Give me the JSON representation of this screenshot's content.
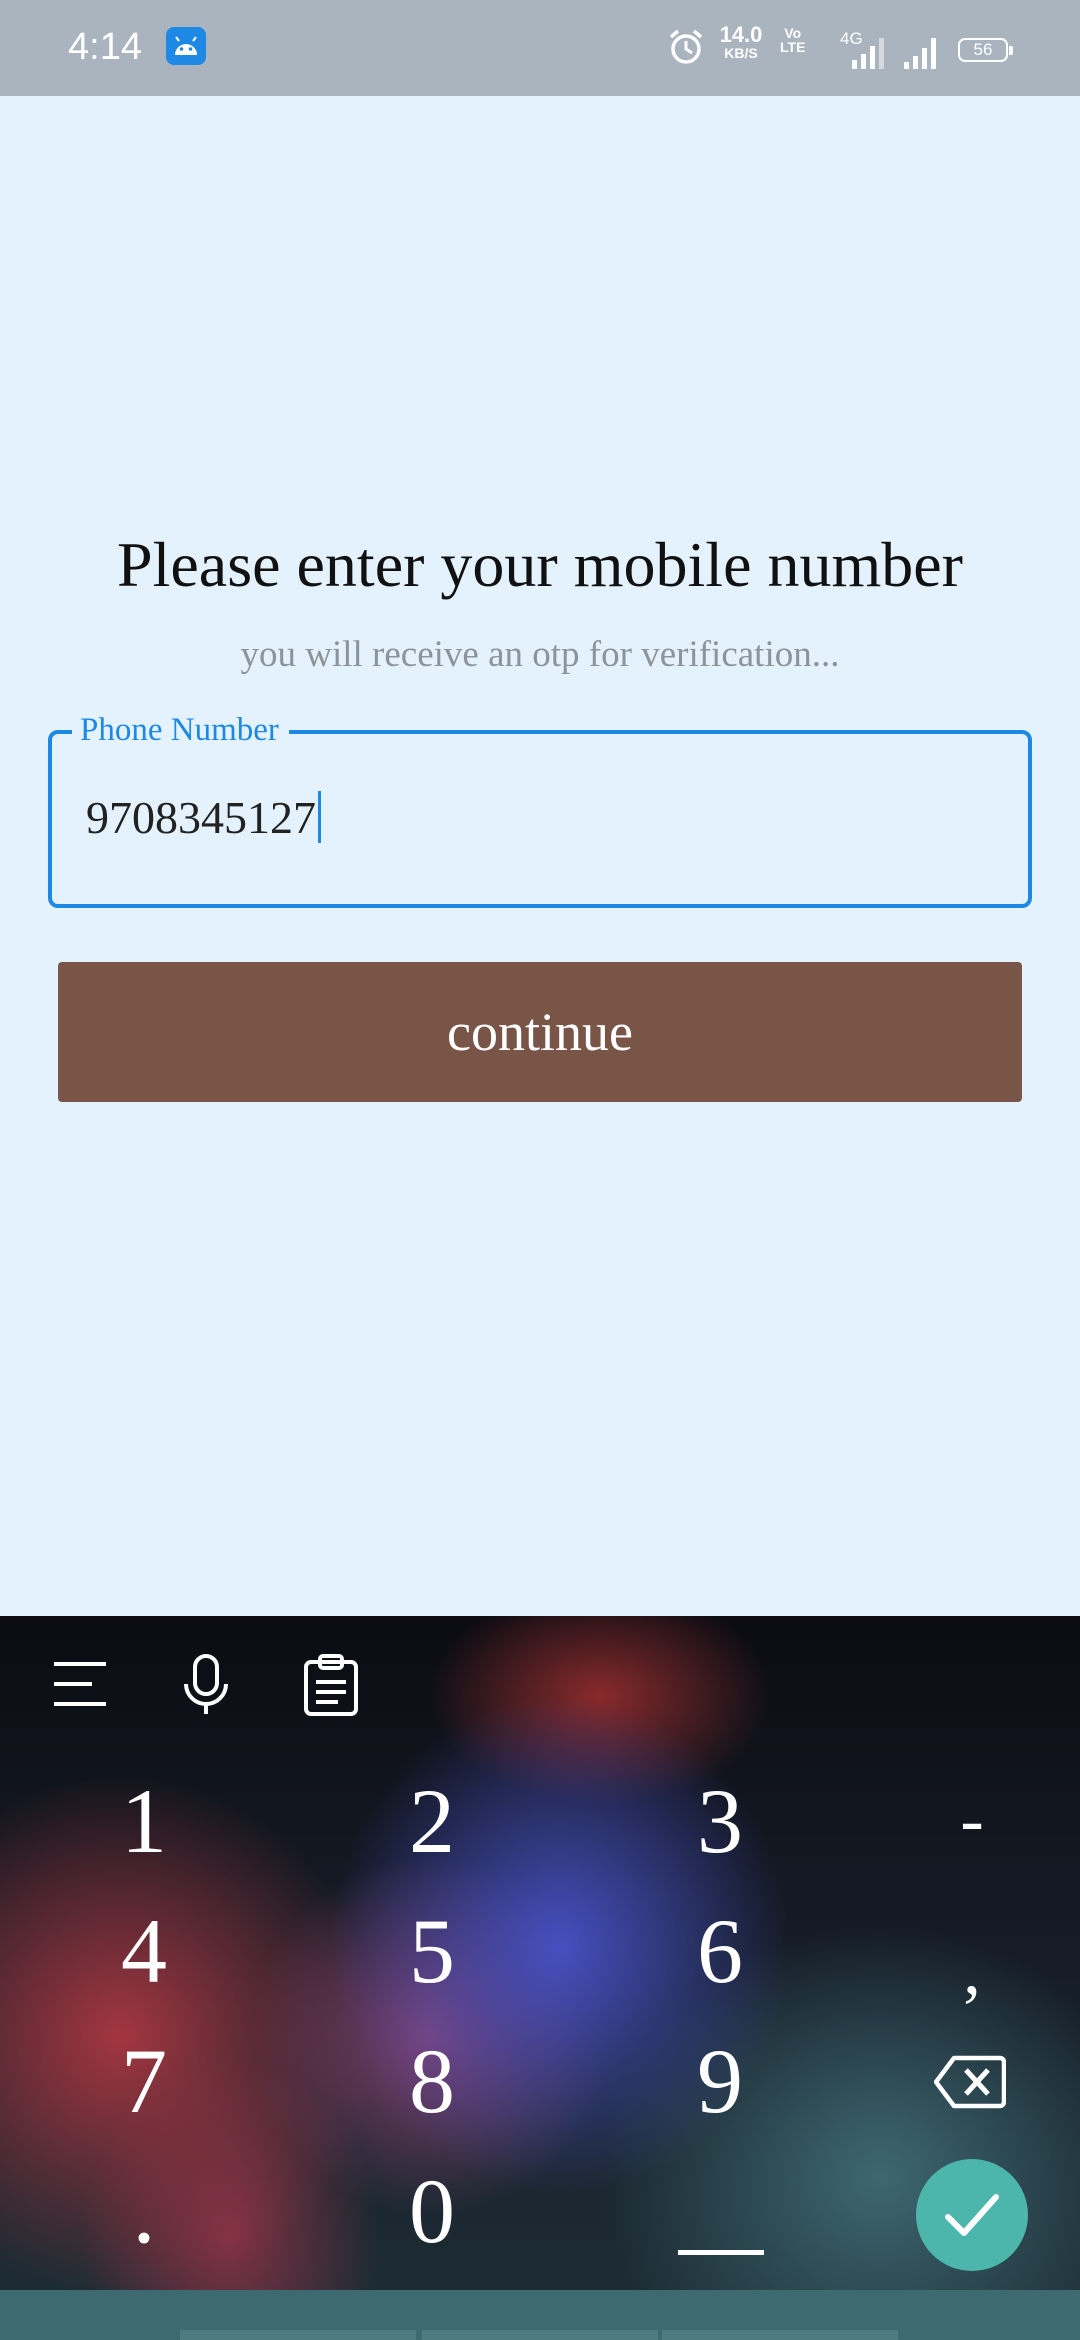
{
  "status_bar": {
    "time": "4:14",
    "net_speed_value": "14.0",
    "net_speed_unit": "KB/S",
    "volte_top": "Vo",
    "volte_bottom": "LTE",
    "network_type": "4G",
    "battery": "56"
  },
  "screen": {
    "title": "Please enter your mobile number",
    "subtitle": "you will receive an otp for verification...",
    "phone_field": {
      "label": "Phone Number",
      "value": "9708345127"
    },
    "continue_label": "continue"
  },
  "keyboard": {
    "keys": [
      {
        "label": "1",
        "name": "key-1"
      },
      {
        "label": "2",
        "name": "key-2"
      },
      {
        "label": "3",
        "name": "key-3"
      },
      {
        "label": "-",
        "name": "key-hyphen"
      },
      {
        "label": "4",
        "name": "key-4"
      },
      {
        "label": "5",
        "name": "key-5"
      },
      {
        "label": "6",
        "name": "key-6"
      },
      {
        "label": ",",
        "name": "key-comma"
      },
      {
        "label": "7",
        "name": "key-7"
      },
      {
        "label": "8",
        "name": "key-8"
      },
      {
        "label": "9",
        "name": "key-9"
      },
      {
        "label": ".",
        "name": "key-period"
      },
      {
        "label": "0",
        "name": "key-0"
      }
    ],
    "icons": [
      "menu-icon",
      "microphone-icon",
      "clipboard-icon",
      "backspace-icon",
      "checkmark-icon"
    ]
  },
  "colors": {
    "background": "#e3f2fd",
    "accent": "#1e88e5",
    "button": "#795548",
    "done_key": "#4db6ac"
  }
}
